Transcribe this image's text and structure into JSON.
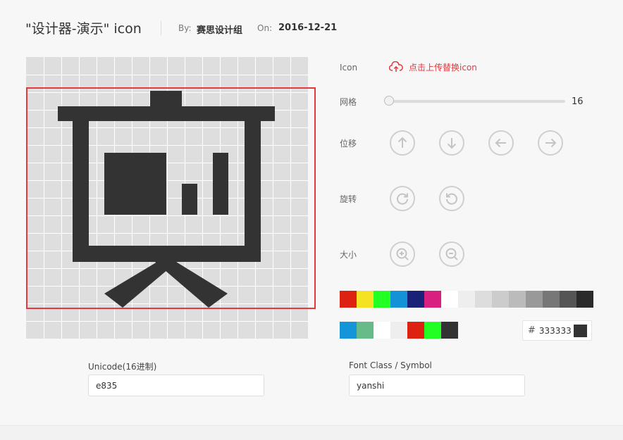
{
  "header": {
    "title": "\"设计器-演示\" icon",
    "by_label": "By:",
    "by_value": "赛思设计组",
    "on_label": "On:",
    "on_value": "2016-12-21"
  },
  "controls": {
    "icon_label": "Icon",
    "upload_text": "点击上传替换icon",
    "grid_label": "网格",
    "grid_value": "16",
    "grid_slider_level": 0,
    "move_label": "位移",
    "rotate_label": "旋转",
    "size_label": "大小",
    "move_icons": [
      "arrow-up-icon",
      "arrow-down-icon",
      "arrow-left-icon",
      "arrow-right-icon"
    ],
    "rotate_icons": [
      "rotate-clockwise-icon",
      "rotate-counterclockwise-icon"
    ],
    "size_icons": [
      "zoom-in-icon",
      "zoom-out-icon"
    ]
  },
  "palette_main": [
    "#dd2211",
    "#f5e222",
    "#22ff22",
    "#1492d8",
    "#1a2277",
    "#d91f80",
    "#ffffff",
    "#eeeeee",
    "#dddddd",
    "#cccccc",
    "#bbbbbb",
    "#999999",
    "#777777",
    "#555555",
    "#2b2b2b"
  ],
  "palette_recent": [
    "#1595d9",
    "#66bb88",
    "#ffffff",
    "#eeeeee",
    "#dd2211",
    "#22ff22",
    "#333333"
  ],
  "color_field": {
    "hash": "#",
    "value": "333333",
    "preview_color": "#333333"
  },
  "fields": {
    "unicode_label": "Unicode(16进制)",
    "unicode_value": "e835",
    "class_label": "Font Class / Symbol",
    "class_value": "yanshi"
  },
  "colors": {
    "accent": "#e4393c",
    "icon_fill": "#333333"
  }
}
